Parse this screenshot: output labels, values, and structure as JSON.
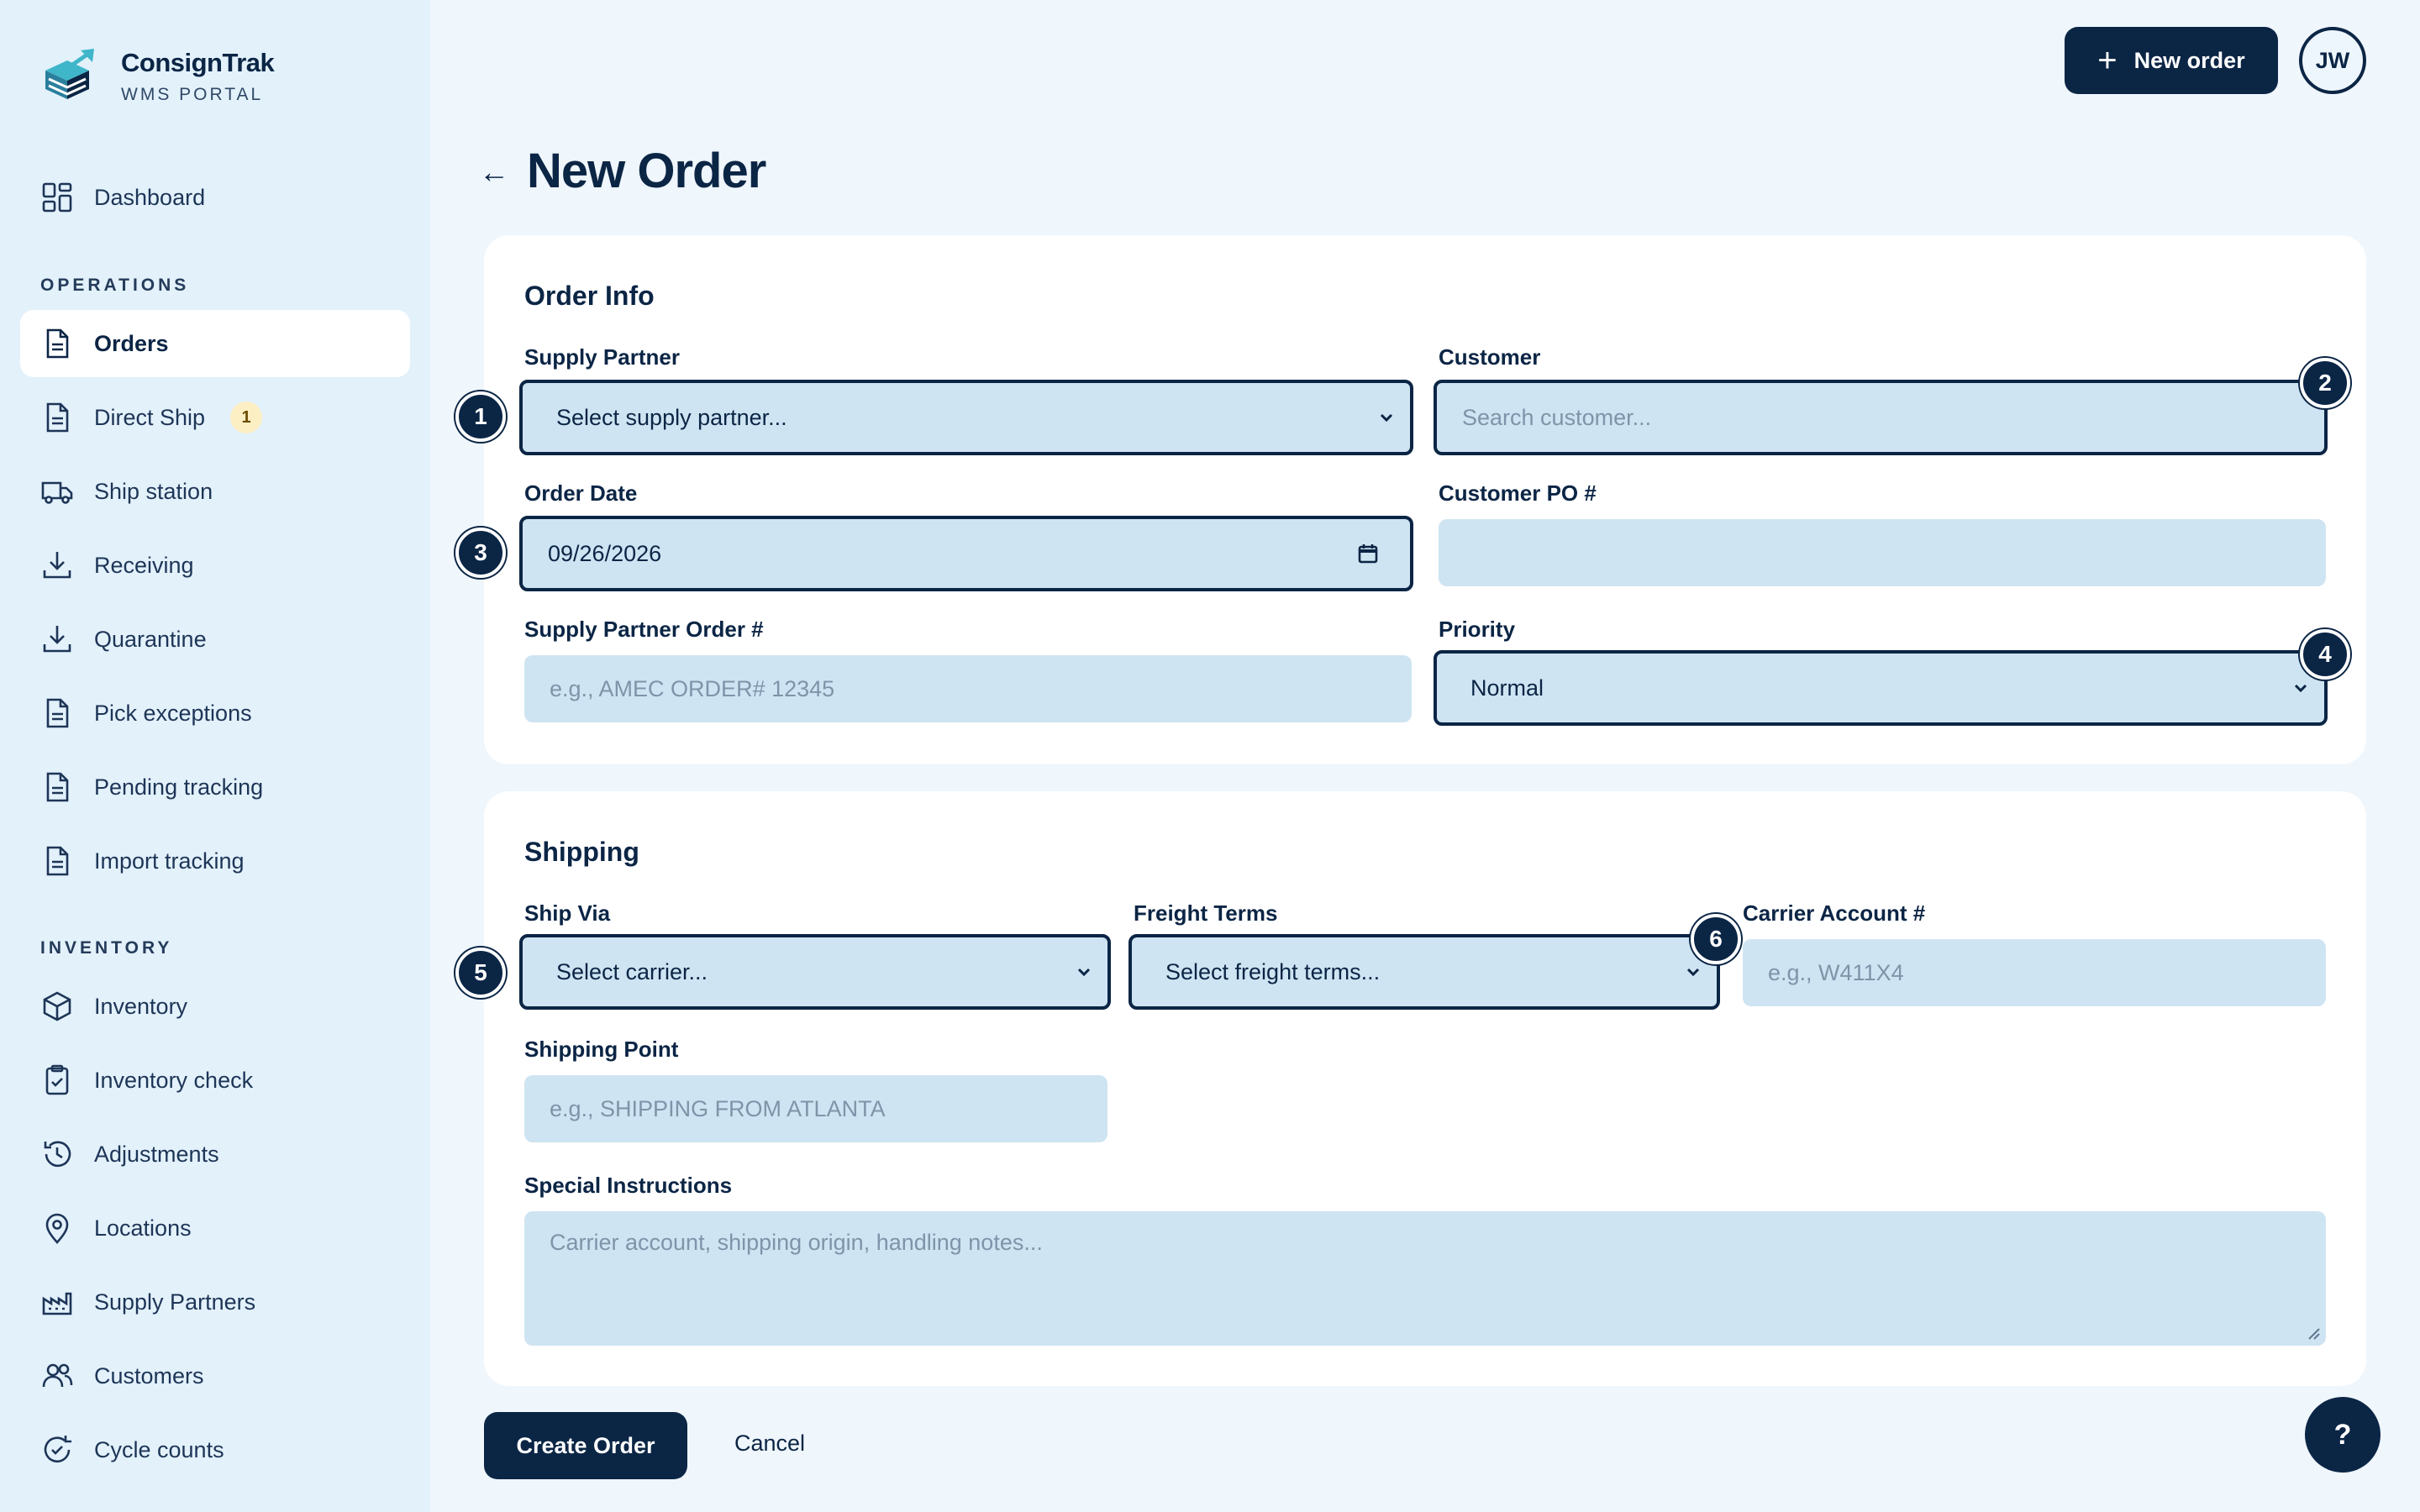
{
  "brand": {
    "name": "ConsignTrak",
    "sub": "WMS PORTAL"
  },
  "nav": {
    "dashboard": "Dashboard",
    "operations_label": "OPERATIONS",
    "operations": [
      {
        "label": "Orders",
        "icon": "document-icon",
        "active": true
      },
      {
        "label": "Direct Ship",
        "icon": "document-icon",
        "badge": "1"
      },
      {
        "label": "Ship station",
        "icon": "truck-icon"
      },
      {
        "label": "Receiving",
        "icon": "download-icon"
      },
      {
        "label": "Quarantine",
        "icon": "download-icon"
      },
      {
        "label": "Pick exceptions",
        "icon": "document-icon"
      },
      {
        "label": "Pending tracking",
        "icon": "document-icon"
      },
      {
        "label": "Import tracking",
        "icon": "document-icon"
      }
    ],
    "inventory_label": "INVENTORY",
    "inventory": [
      {
        "label": "Inventory",
        "icon": "box-icon"
      },
      {
        "label": "Inventory check",
        "icon": "clipboard-check-icon"
      },
      {
        "label": "Adjustments",
        "icon": "history-icon"
      },
      {
        "label": "Locations",
        "icon": "map-pin-icon"
      },
      {
        "label": "Supply Partners",
        "icon": "factory-icon"
      },
      {
        "label": "Customers",
        "icon": "users-icon"
      },
      {
        "label": "Cycle counts",
        "icon": "refresh-check-icon"
      }
    ]
  },
  "header": {
    "new_order": "New order",
    "avatar": "JW"
  },
  "page": {
    "back": "←",
    "title": "New Order"
  },
  "order_info": {
    "title": "Order Info",
    "supply_partner": {
      "label": "Supply Partner",
      "value": "Select supply partner..."
    },
    "customer": {
      "label": "Customer",
      "placeholder": "Search customer..."
    },
    "order_date": {
      "label": "Order Date",
      "value": "09/26/2026"
    },
    "customer_po": {
      "label": "Customer PO #",
      "value": ""
    },
    "supply_partner_order": {
      "label": "Supply Partner Order #",
      "placeholder": "e.g., AMEC ORDER# 12345"
    },
    "priority": {
      "label": "Priority",
      "value": "Normal"
    }
  },
  "shipping": {
    "title": "Shipping",
    "ship_via": {
      "label": "Ship Via",
      "value": "Select carrier..."
    },
    "freight_terms": {
      "label": "Freight Terms",
      "value": "Select freight terms..."
    },
    "carrier_account": {
      "label": "Carrier Account #",
      "placeholder": "e.g., W411X4"
    },
    "shipping_point": {
      "label": "Shipping Point",
      "placeholder": "e.g., SHIPPING FROM ATLANTA"
    },
    "special_instructions": {
      "label": "Special Instructions",
      "placeholder": "Carrier account, shipping origin, handling notes..."
    }
  },
  "markers": [
    "1",
    "2",
    "3",
    "4",
    "5",
    "6"
  ],
  "actions": {
    "create": "Create Order",
    "cancel": "Cancel",
    "help": "?"
  },
  "colors": {
    "primary": "#0b2545",
    "field_bg": "#cfe4f2",
    "sidebar_bg": "#e3f1fb",
    "page_bg": "#eff6fc",
    "badge_bg": "#fcefc4"
  }
}
